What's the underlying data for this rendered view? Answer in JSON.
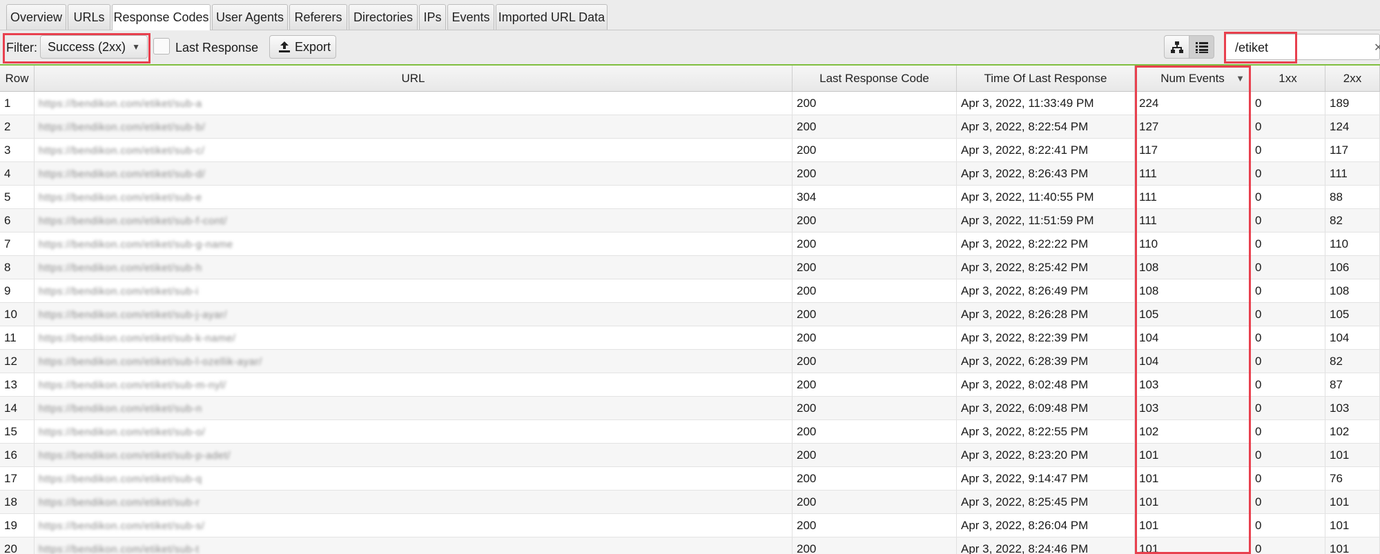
{
  "tabs": [
    {
      "label": "Overview",
      "active": false
    },
    {
      "label": "URLs",
      "active": false
    },
    {
      "label": "Response Codes",
      "active": true
    },
    {
      "label": "User Agents",
      "active": false
    },
    {
      "label": "Referers",
      "active": false
    },
    {
      "label": "Directories",
      "active": false
    },
    {
      "label": "IPs",
      "active": false
    },
    {
      "label": "Events",
      "active": false
    },
    {
      "label": "Imported URL Data",
      "active": false
    }
  ],
  "toolbar": {
    "filter_label": "Filter:",
    "filter_value": "Success (2xx)",
    "last_response_label": "Last Response",
    "last_response_checked": false,
    "export_label": "Export",
    "search_value": "/etiket",
    "view_mode": "list"
  },
  "icons": {
    "export": "upload-icon",
    "tree_view": "tree-icon",
    "list_view": "list-icon",
    "dropdown": "chevron-down-icon",
    "sort": "sort-descending-icon",
    "clear": "close-icon"
  },
  "colors": {
    "highlight": "#e8404e",
    "toolbar_accent": "#7fbf3f"
  },
  "columns": [
    "Row",
    "URL",
    "Last Response Code",
    "Time Of Last Response",
    "Num Events",
    "1xx",
    "2xx"
  ],
  "sorted_column": "Num Events",
  "rows": [
    {
      "row": "1",
      "url": "https://bendikon.com/etiket/sub-a",
      "code": "200",
      "time": "Apr 3, 2022, 11:33:49 PM",
      "events": "224",
      "c1xx": "0",
      "c2xx": "189"
    },
    {
      "row": "2",
      "url": "https://bendikon.com/etiket/sub-b/",
      "code": "200",
      "time": "Apr 3, 2022, 8:22:54 PM",
      "events": "127",
      "c1xx": "0",
      "c2xx": "124"
    },
    {
      "row": "3",
      "url": "https://bendikon.com/etiket/sub-c/",
      "code": "200",
      "time": "Apr 3, 2022, 8:22:41 PM",
      "events": "117",
      "c1xx": "0",
      "c2xx": "117"
    },
    {
      "row": "4",
      "url": "https://bendikon.com/etiket/sub-d/",
      "code": "200",
      "time": "Apr 3, 2022, 8:26:43 PM",
      "events": "111",
      "c1xx": "0",
      "c2xx": "111"
    },
    {
      "row": "5",
      "url": "https://bendikon.com/etiket/sub-e",
      "code": "304",
      "time": "Apr 3, 2022, 11:40:55 PM",
      "events": "111",
      "c1xx": "0",
      "c2xx": "88"
    },
    {
      "row": "6",
      "url": "https://bendikon.com/etiket/sub-f-cont/",
      "code": "200",
      "time": "Apr 3, 2022, 11:51:59 PM",
      "events": "111",
      "c1xx": "0",
      "c2xx": "82"
    },
    {
      "row": "7",
      "url": "https://bendikon.com/etiket/sub-g-name",
      "code": "200",
      "time": "Apr 3, 2022, 8:22:22 PM",
      "events": "110",
      "c1xx": "0",
      "c2xx": "110"
    },
    {
      "row": "8",
      "url": "https://bendikon.com/etiket/sub-h",
      "code": "200",
      "time": "Apr 3, 2022, 8:25:42 PM",
      "events": "108",
      "c1xx": "0",
      "c2xx": "106"
    },
    {
      "row": "9",
      "url": "https://bendikon.com/etiket/sub-i",
      "code": "200",
      "time": "Apr 3, 2022, 8:26:49 PM",
      "events": "108",
      "c1xx": "0",
      "c2xx": "108"
    },
    {
      "row": "10",
      "url": "https://bendikon.com/etiket/sub-j-ayar/",
      "code": "200",
      "time": "Apr 3, 2022, 8:26:28 PM",
      "events": "105",
      "c1xx": "0",
      "c2xx": "105"
    },
    {
      "row": "11",
      "url": "https://bendikon.com/etiket/sub-k-name/",
      "code": "200",
      "time": "Apr 3, 2022, 8:22:39 PM",
      "events": "104",
      "c1xx": "0",
      "c2xx": "104"
    },
    {
      "row": "12",
      "url": "https://bendikon.com/etiket/sub-l-ozellik-ayar/",
      "code": "200",
      "time": "Apr 3, 2022, 6:28:39 PM",
      "events": "104",
      "c1xx": "0",
      "c2xx": "82"
    },
    {
      "row": "13",
      "url": "https://bendikon.com/etiket/sub-m-nyl/",
      "code": "200",
      "time": "Apr 3, 2022, 8:02:48 PM",
      "events": "103",
      "c1xx": "0",
      "c2xx": "87"
    },
    {
      "row": "14",
      "url": "https://bendikon.com/etiket/sub-n",
      "code": "200",
      "time": "Apr 3, 2022, 6:09:48 PM",
      "events": "103",
      "c1xx": "0",
      "c2xx": "103"
    },
    {
      "row": "15",
      "url": "https://bendikon.com/etiket/sub-o/",
      "code": "200",
      "time": "Apr 3, 2022, 8:22:55 PM",
      "events": "102",
      "c1xx": "0",
      "c2xx": "102"
    },
    {
      "row": "16",
      "url": "https://bendikon.com/etiket/sub-p-adet/",
      "code": "200",
      "time": "Apr 3, 2022, 8:23:20 PM",
      "events": "101",
      "c1xx": "0",
      "c2xx": "101"
    },
    {
      "row": "17",
      "url": "https://bendikon.com/etiket/sub-q",
      "code": "200",
      "time": "Apr 3, 2022, 9:14:47 PM",
      "events": "101",
      "c1xx": "0",
      "c2xx": "76"
    },
    {
      "row": "18",
      "url": "https://bendikon.com/etiket/sub-r",
      "code": "200",
      "time": "Apr 3, 2022, 8:25:45 PM",
      "events": "101",
      "c1xx": "0",
      "c2xx": "101"
    },
    {
      "row": "19",
      "url": "https://bendikon.com/etiket/sub-s/",
      "code": "200",
      "time": "Apr 3, 2022, 8:26:04 PM",
      "events": "101",
      "c1xx": "0",
      "c2xx": "101"
    },
    {
      "row": "20",
      "url": "https://bendikon.com/etiket/sub-t",
      "code": "200",
      "time": "Apr 3, 2022, 8:24:46 PM",
      "events": "101",
      "c1xx": "0",
      "c2xx": "101"
    }
  ]
}
